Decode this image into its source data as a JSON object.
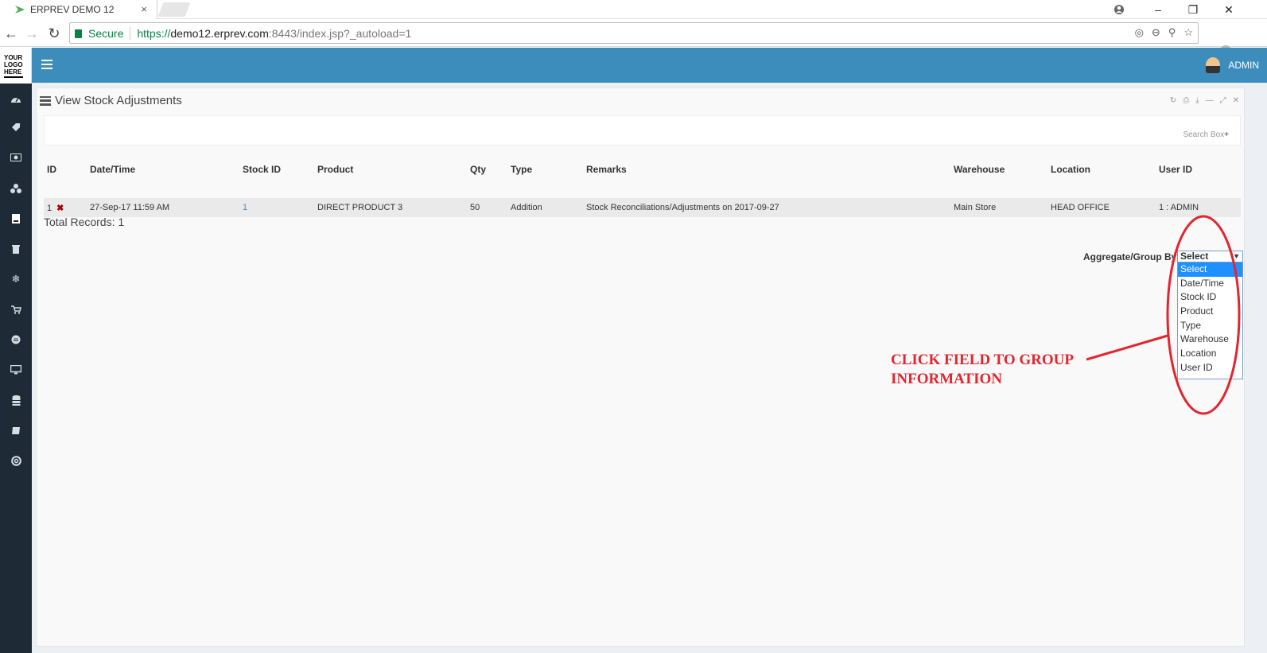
{
  "browser": {
    "tab_title": "ERPREV DEMO 12",
    "tab_close": "×",
    "secure_label": "Secure",
    "url_scheme": "https://",
    "url_host": "demo12.erprev.com",
    "url_rest": ":8443/index.jsp?_autoload=1",
    "window_controls": [
      "–",
      "❐",
      "✕"
    ]
  },
  "sidebar": {
    "logo_lines": [
      "YOUR",
      "LOGO",
      "HERE"
    ],
    "icons": [
      "dashboard-icon",
      "tag-icon",
      "money-icon",
      "cubes-icon",
      "document-icon",
      "trash-icon",
      "snowflake-icon",
      "cart-icon",
      "disc-icon",
      "monitor-icon",
      "database-icon",
      "book-icon",
      "lifebuoy-icon"
    ]
  },
  "header": {
    "user_name": "ADMIN"
  },
  "panel": {
    "title": "View Stock Adjustments",
    "search_box_label": "Search Box"
  },
  "table": {
    "columns": [
      "ID",
      "Date/Time",
      "Stock ID",
      "Product",
      "Qty",
      "Type",
      "Remarks",
      "Warehouse",
      "Location",
      "User ID"
    ],
    "rows": [
      {
        "id": "1",
        "datetime": "27-Sep-17 11:59 AM",
        "stock_id": "1",
        "product": "DIRECT PRODUCT 3",
        "qty": "50",
        "type": "Addition",
        "remarks": "Stock Reconciliations/Adjustments on 2017-09-27",
        "warehouse": "Main Store",
        "location": "HEAD OFFICE",
        "user_id": "1 : ADMIN"
      }
    ]
  },
  "total_records": "Total Records: 1",
  "aggregate": {
    "label": "Aggregate/Group By:",
    "selected": "Select",
    "options": [
      "Select",
      "Date/Time",
      "Stock ID",
      "Product",
      "Type",
      "Warehouse",
      "Location",
      "User ID"
    ]
  },
  "annotation": {
    "line1": "CLICK FIELD TO GROUP",
    "line2": "INFORMATION",
    "color": "#e3252f"
  },
  "colors": {
    "header_blue": "#3c8dbc",
    "sidebar_dark": "#1e2b36",
    "secure_green": "#0b8043"
  }
}
